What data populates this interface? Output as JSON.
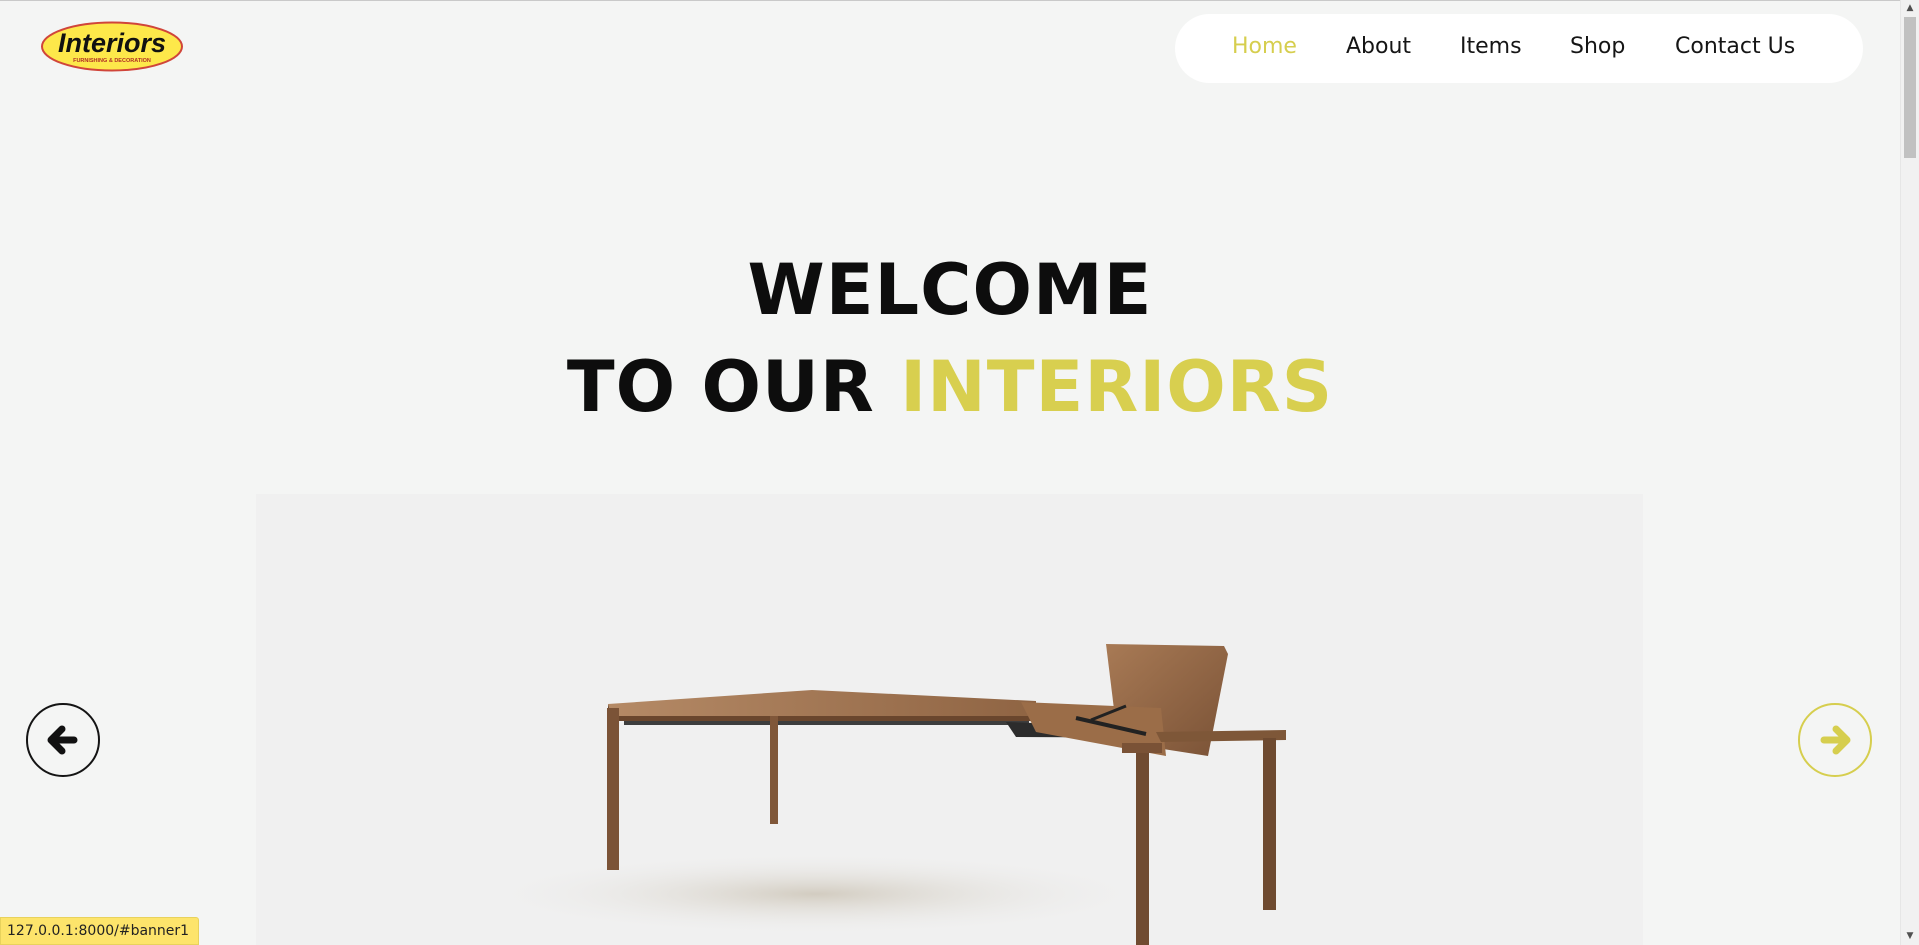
{
  "brand": {
    "logo_text": "Interiors",
    "logo_tagline": "FURNISHING & DECORATION"
  },
  "nav": {
    "items": [
      {
        "label": "Home",
        "active": true
      },
      {
        "label": "About",
        "active": false
      },
      {
        "label": "Items",
        "active": false
      },
      {
        "label": "Shop",
        "active": false
      },
      {
        "label": "Contact Us",
        "active": false
      }
    ]
  },
  "hero": {
    "line1": "WELCOME",
    "line2_prefix": "TO OUR ",
    "line2_accent": "INTERIORS"
  },
  "carousel": {
    "prev_icon": "arrow-left-icon",
    "next_icon": "arrow-right-icon",
    "image_subject": "extendable-wooden-table"
  },
  "status_bar": {
    "url": "127.0.0.1:8000/#banner1"
  },
  "colors": {
    "accent": "#d8cf4f",
    "background": "#f4f5f4",
    "text": "#0d0d0d",
    "nav_bg": "#ffffff"
  }
}
